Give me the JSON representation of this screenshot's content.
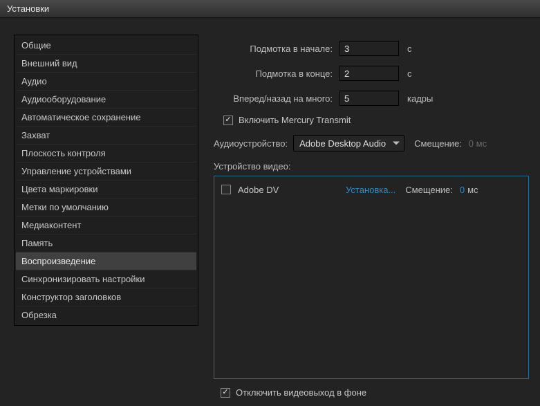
{
  "window": {
    "title": "Установки"
  },
  "sidebar": {
    "items": [
      {
        "label": "Общие"
      },
      {
        "label": "Внешний вид"
      },
      {
        "label": "Аудио"
      },
      {
        "label": "Аудиооборудование"
      },
      {
        "label": "Автоматическое сохранение"
      },
      {
        "label": "Захват"
      },
      {
        "label": "Плоскость контроля"
      },
      {
        "label": "Управление устройствами"
      },
      {
        "label": "Цвета маркировки"
      },
      {
        "label": "Метки по умолчанию"
      },
      {
        "label": "Медиаконтент"
      },
      {
        "label": "Память"
      },
      {
        "label": "Воспроизведение"
      },
      {
        "label": "Синхронизировать настройки"
      },
      {
        "label": "Конструктор заголовков"
      },
      {
        "label": "Обрезка"
      }
    ],
    "selectedIndex": 12
  },
  "form": {
    "preroll": {
      "label": "Подмотка в начале:",
      "value": "3",
      "unit": "с"
    },
    "postroll": {
      "label": "Подмотка в конце:",
      "value": "2",
      "unit": "с"
    },
    "step": {
      "label": "Вперед/назад на много:",
      "value": "5",
      "unit": "кадры"
    },
    "mercury": {
      "label": "Включить Mercury Transmit",
      "checked": true
    },
    "audioDevice": {
      "label": "Аудиоустройство:",
      "value": "Adobe Desktop Audio",
      "offsetLabel": "Смещение:",
      "offsetValue": "0",
      "offsetUnit": "мс"
    },
    "videoDevice": {
      "label": "Устройство видео:",
      "rows": [
        {
          "name": "Adobe DV",
          "link": "Установка...",
          "offsetLabel": "Смещение:",
          "offsetValue": "0",
          "offsetUnit": "мс",
          "checked": false
        }
      ]
    },
    "disableBg": {
      "label": "Отключить видеовыход в фоне",
      "checked": true
    }
  }
}
